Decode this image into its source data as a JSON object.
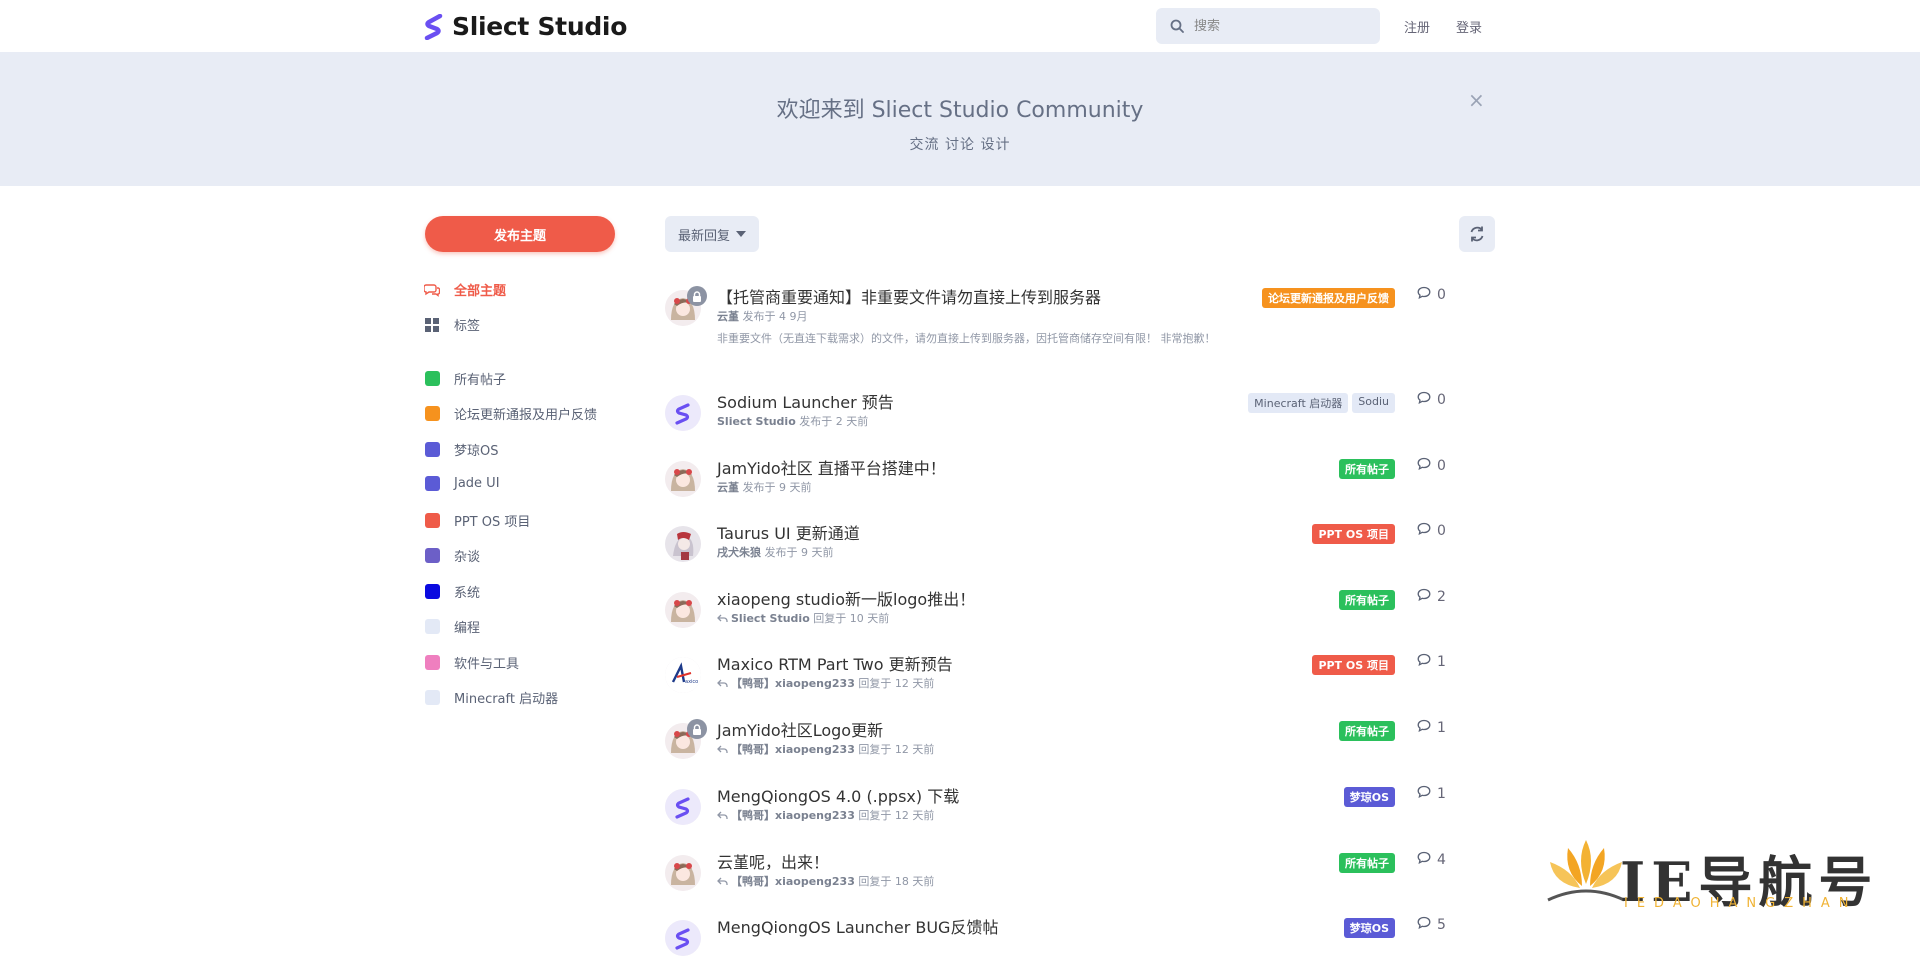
{
  "header": {
    "brand": "Sliect Studio",
    "search_placeholder": "搜索",
    "register": "注册",
    "login": "登录"
  },
  "hero": {
    "title": "欢迎来到 Sliect Studio Community",
    "subtitle": "交流 讨论 设计",
    "close": "×"
  },
  "sidebar": {
    "new_button": "发布主题",
    "nav": [
      {
        "label": "全部主题",
        "icon": "comments-icon"
      },
      {
        "label": "标签",
        "icon": "tags-grid-icon"
      }
    ],
    "tags": [
      {
        "label": "所有帖子",
        "color": "#2bc05c"
      },
      {
        "label": "论坛更新通报及用户反馈",
        "color": "#f6921e"
      },
      {
        "label": "梦琼OS",
        "color": "#5b5bd6"
      },
      {
        "label": "Jade UI",
        "color": "#5b5bd6"
      },
      {
        "label": "PPT OS 项目",
        "color": "#ef5b49"
      },
      {
        "label": "杂谈",
        "color": "#6c5fc7"
      },
      {
        "label": "系统",
        "color": "#0a0ae0"
      },
      {
        "label": "编程",
        "color": "#e3e9f6"
      },
      {
        "label": "软件与工具",
        "color": "#ef7fbf"
      },
      {
        "label": "Minecraft 启动器",
        "color": "#e3e9f6"
      }
    ]
  },
  "toolbar": {
    "sort_label": "最新回复",
    "refresh": "refresh-icon"
  },
  "discussions": [
    {
      "title": "【托管商重要通知】非重要文件请勿直接上传到服务器",
      "user": "云堇",
      "action": "发布于 4 9月",
      "excerpt": "非重要文件（无直连下载需求）的文件，请勿直接上传到服务器，因托管商储存空间有限！ 非常抱歉！",
      "tags": [
        {
          "label": "论坛更新通报及用户反馈",
          "color": "#f6921e"
        }
      ],
      "count": "0",
      "avatar": "girl",
      "locked": true,
      "reply": false
    },
    {
      "title": "Sodium Launcher 预告",
      "user": "Sliect Studio",
      "action": "发布于 2 天前",
      "tags": [
        {
          "label": "Minecraft 启动器",
          "color": "#e3e9f6",
          "light": true
        },
        {
          "label": "Sodiu",
          "color": "#e3e9f6",
          "light": true
        }
      ],
      "count": "0",
      "avatar": "logo",
      "locked": false,
      "reply": false
    },
    {
      "title": "JamYido社区 直播平台搭建中！",
      "user": "云堇",
      "action": "发布于 9 天前",
      "tags": [
        {
          "label": "所有帖子",
          "color": "#2bc05c"
        }
      ],
      "count": "0",
      "avatar": "girl",
      "locked": false,
      "reply": false
    },
    {
      "title": "Taurus UI 更新通道",
      "user": "戌犬朱狼",
      "action": "发布于 9 天前",
      "tags": [
        {
          "label": "PPT OS 项目",
          "color": "#ef5b49"
        }
      ],
      "count": "0",
      "avatar": "anime",
      "locked": false,
      "reply": false
    },
    {
      "title": "xiaopeng studio新一版logo推出！",
      "user": "Sliect Studio",
      "action": "回复于 10 天前",
      "tags": [
        {
          "label": "所有帖子",
          "color": "#2bc05c"
        }
      ],
      "count": "2",
      "avatar": "girl",
      "locked": false,
      "reply": true
    },
    {
      "title": "Maxico RTM Part Two 更新预告",
      "user": "【鸭哥】xiaopeng233",
      "action": "回复于 12 天前",
      "tags": [
        {
          "label": "PPT OS 项目",
          "color": "#ef5b49"
        }
      ],
      "count": "1",
      "avatar": "maxico",
      "locked": false,
      "reply": true
    },
    {
      "title": "JamYido社区Logo更新",
      "user": "【鸭哥】xiaopeng233",
      "action": "回复于 12 天前",
      "tags": [
        {
          "label": "所有帖子",
          "color": "#2bc05c"
        }
      ],
      "count": "1",
      "avatar": "girl",
      "locked": true,
      "reply": true
    },
    {
      "title": "MengQiongOS 4.0 (.ppsx) 下载",
      "user": "【鸭哥】xiaopeng233",
      "action": "回复于 12 天前",
      "tags": [
        {
          "label": "梦琼OS",
          "color": "#5b5bd6"
        }
      ],
      "count": "1",
      "avatar": "logo",
      "locked": false,
      "reply": true
    },
    {
      "title": "云堇呢，出来！",
      "user": "【鸭哥】xiaopeng233",
      "action": "回复于 18 天前",
      "tags": [
        {
          "label": "所有帖子",
          "color": "#2bc05c"
        }
      ],
      "count": "4",
      "avatar": "girl",
      "locked": false,
      "reply": true
    },
    {
      "title": "MengQiongOS Launcher BUG反馈帖",
      "user": "",
      "action": "",
      "tags": [
        {
          "label": "梦琼OS",
          "color": "#5b5bd6"
        }
      ],
      "count": "5",
      "avatar": "logo",
      "locked": false,
      "reply": false
    }
  ],
  "watermark": {
    "text": "IE导航号",
    "sub": "IEDAOHANGZHAN"
  }
}
